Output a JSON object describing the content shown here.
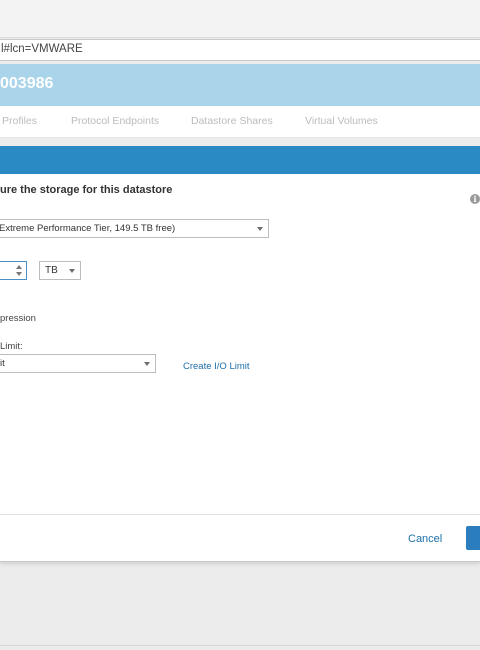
{
  "browser": {
    "url_text": "l#lcn=VMWARE"
  },
  "header": {
    "title": "003986"
  },
  "tabs": [
    {
      "label": "Profiles"
    },
    {
      "label": "Protocol Endpoints"
    },
    {
      "label": "Datastore Shares"
    },
    {
      "label": "Virtual Volumes"
    }
  ],
  "dialog": {
    "title": "ure the storage for this datastore",
    "info_icon": "i",
    "tier_select": {
      "value": "Extreme Performance Tier, 149.5 TB free)"
    },
    "size_input": {
      "value": ""
    },
    "unit_select": {
      "value": "TB"
    },
    "compression_label": "pression",
    "io_limit_label": "Limit:",
    "io_select": {
      "value": "it"
    },
    "create_io_link": "Create I/O Limit",
    "cancel_label": "Cancel",
    "primary_label": ""
  },
  "colors": {
    "banner": "#aad4ea",
    "dialog_header": "#2a8ac3",
    "link": "#1e6fa8",
    "primary_button": "#2a7ec0"
  }
}
